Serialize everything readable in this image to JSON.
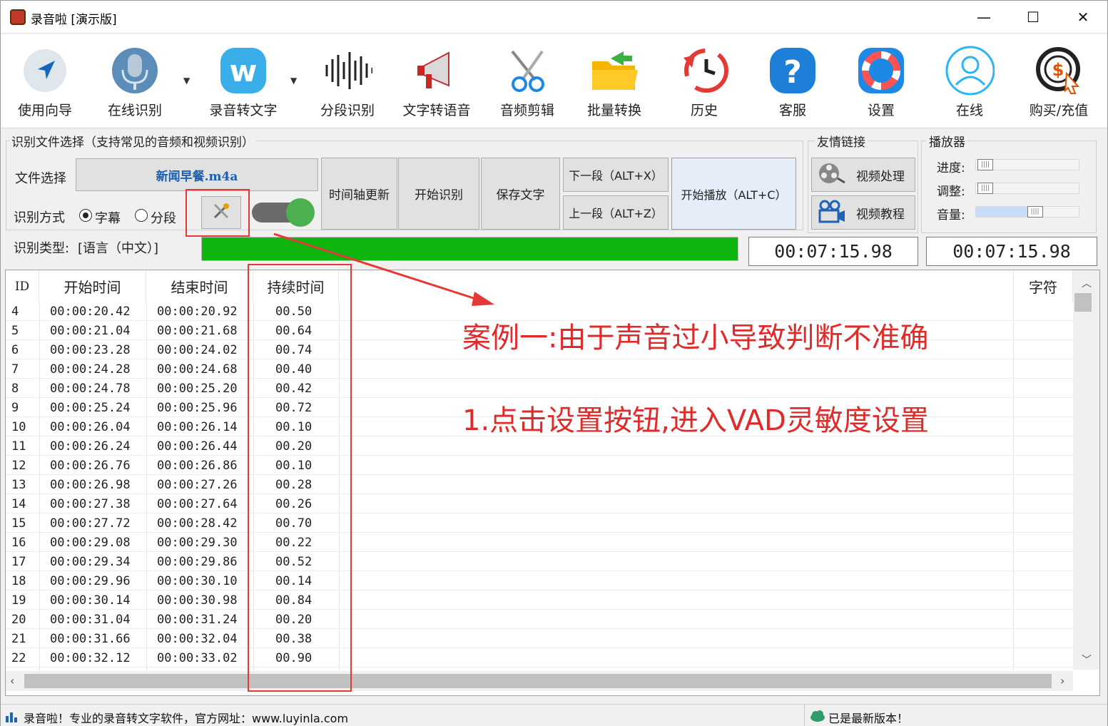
{
  "window": {
    "title": "录音啦 [演示版]",
    "minimize": "—",
    "maximize": "☐",
    "close": "✕"
  },
  "toolbar": [
    {
      "label": "使用向导",
      "icon": "navigation-arrow-icon"
    },
    {
      "label": "在线识别",
      "icon": "microphone-icon"
    },
    {
      "label": "录音转文字",
      "icon": "w-logo-icon"
    },
    {
      "label": "分段识别",
      "icon": "soundwave-icon"
    },
    {
      "label": "文字转语音",
      "icon": "megaphone-icon"
    },
    {
      "label": "音频剪辑",
      "icon": "scissors-icon"
    },
    {
      "label": "批量转换",
      "icon": "folder-icon"
    },
    {
      "label": "历史",
      "icon": "history-clock-icon"
    },
    {
      "label": "客服",
      "icon": "help-icon"
    },
    {
      "label": "设置",
      "icon": "lifebuoy-icon"
    },
    {
      "label": "在线",
      "icon": "user-online-icon"
    },
    {
      "label": "购买/充值",
      "icon": "purchase-dollar-icon"
    }
  ],
  "dropdown_glyph": "▼",
  "recog": {
    "group_title": "识别文件选择（支持常见的音频和视频识别）",
    "file_label": "文件选择",
    "file_name": "新闻早餐.m4a",
    "mode_label": "识别方式",
    "mode_subtitle": "字幕",
    "mode_segment": "分段",
    "type_label": "识别类型:",
    "type_value": "[语言（中文）]",
    "progress": 1.0
  },
  "buttons": {
    "timeline": "时间轴更新",
    "start": "开始识别",
    "save": "保存文字",
    "next": "下一段（ALT+X）",
    "prev": "上一段（ALT+Z）",
    "play": "开始播放（ALT+C）"
  },
  "links": {
    "title": "友情链接",
    "video_process": "视频处理",
    "video_tutorial": "视频教程"
  },
  "player": {
    "title": "播放器",
    "progress_label": "进度:",
    "adjust_label": "调整:",
    "volume_label": "音量:",
    "progress": 0.0,
    "adjust": 0.0,
    "volume": 0.57,
    "thumb_glyph": "||||"
  },
  "time1": "00:07:15.98",
  "time2": "00:07:15.98",
  "table": {
    "headers": {
      "id": "ID",
      "start": "开始时间",
      "end": "结束时间",
      "duration": "持续时间",
      "chars": "字符"
    },
    "rows": [
      {
        "id": "4",
        "start": "00:00:20.42",
        "end": "00:00:20.92",
        "dur": "00.50"
      },
      {
        "id": "5",
        "start": "00:00:21.04",
        "end": "00:00:21.68",
        "dur": "00.64"
      },
      {
        "id": "6",
        "start": "00:00:23.28",
        "end": "00:00:24.02",
        "dur": "00.74"
      },
      {
        "id": "7",
        "start": "00:00:24.28",
        "end": "00:00:24.68",
        "dur": "00.40"
      },
      {
        "id": "8",
        "start": "00:00:24.78",
        "end": "00:00:25.20",
        "dur": "00.42"
      },
      {
        "id": "9",
        "start": "00:00:25.24",
        "end": "00:00:25.96",
        "dur": "00.72"
      },
      {
        "id": "10",
        "start": "00:00:26.04",
        "end": "00:00:26.14",
        "dur": "00.10"
      },
      {
        "id": "11",
        "start": "00:00:26.24",
        "end": "00:00:26.44",
        "dur": "00.20"
      },
      {
        "id": "12",
        "start": "00:00:26.76",
        "end": "00:00:26.86",
        "dur": "00.10"
      },
      {
        "id": "13",
        "start": "00:00:26.98",
        "end": "00:00:27.26",
        "dur": "00.28"
      },
      {
        "id": "14",
        "start": "00:00:27.38",
        "end": "00:00:27.64",
        "dur": "00.26"
      },
      {
        "id": "15",
        "start": "00:00:27.72",
        "end": "00:00:28.42",
        "dur": "00.70"
      },
      {
        "id": "16",
        "start": "00:00:29.08",
        "end": "00:00:29.30",
        "dur": "00.22"
      },
      {
        "id": "17",
        "start": "00:00:29.34",
        "end": "00:00:29.86",
        "dur": "00.52"
      },
      {
        "id": "18",
        "start": "00:00:29.96",
        "end": "00:00:30.10",
        "dur": "00.14"
      },
      {
        "id": "19",
        "start": "00:00:30.14",
        "end": "00:00:30.98",
        "dur": "00.84"
      },
      {
        "id": "20",
        "start": "00:00:31.04",
        "end": "00:00:31.24",
        "dur": "00.20"
      },
      {
        "id": "21",
        "start": "00:00:31.66",
        "end": "00:00:32.04",
        "dur": "00.38"
      },
      {
        "id": "22",
        "start": "00:00:32.12",
        "end": "00:00:33.02",
        "dur": "00.90"
      }
    ]
  },
  "annotation": {
    "line1": "案例一:由于声音过小导致判断不准确",
    "line2": "1.点击设置按钮,进入VAD灵敏度设置",
    "color": "#e02b2b"
  },
  "status": {
    "left": "录音啦！专业的录音转文字软件，官方网址：www.luyinla.com",
    "right": "已是最新版本！"
  },
  "colors": {
    "progress": "#0fb50f",
    "toggle": "#4caf50",
    "filename": "#1a5fb4",
    "annotation_box": "#e53935"
  }
}
